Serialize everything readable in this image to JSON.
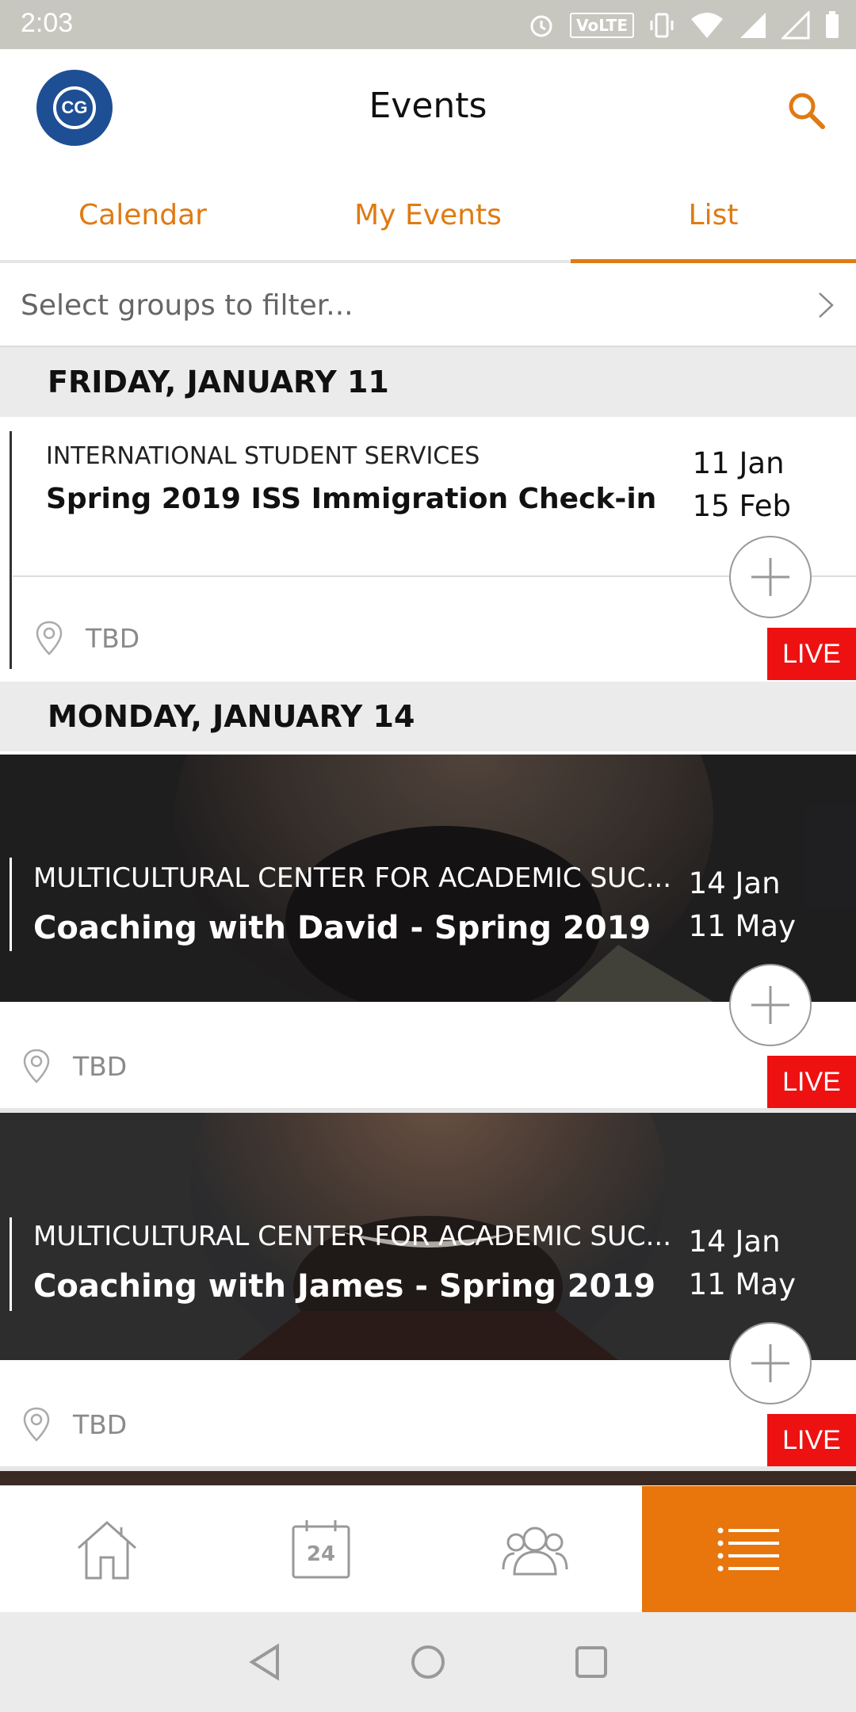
{
  "status_bar": {
    "time": "2:03",
    "volte_label": "VoLTE"
  },
  "header": {
    "title": "Events",
    "logo_text": "CG"
  },
  "tabs": [
    {
      "label": "Calendar",
      "active": false
    },
    {
      "label": "My Events",
      "active": false
    },
    {
      "label": "List",
      "active": true
    }
  ],
  "filter": {
    "placeholder": "Select groups to filter..."
  },
  "sections": [
    {
      "day_label": "FRIDAY, JANUARY 11",
      "events": [
        {
          "org": "INTERNATIONAL STUDENT SERVICES",
          "title": "Spring 2019 ISS Immigration Check-in",
          "start": "11 Jan",
          "end": "15 Feb",
          "location": "TBD",
          "badge": "LIVE"
        }
      ]
    },
    {
      "day_label": "MONDAY, JANUARY 14",
      "events": [
        {
          "org": "MULTICULTURAL CENTER FOR ACADEMIC SUC...",
          "title": "Coaching with David - Spring 2019",
          "start": "14 Jan",
          "end": "11 May",
          "location": "TBD",
          "badge": "LIVE"
        },
        {
          "org": "MULTICULTURAL CENTER FOR ACADEMIC SUC...",
          "title": "Coaching with James - Spring 2019",
          "start": "14 Jan",
          "end": "11 May",
          "location": "TBD",
          "badge": "LIVE"
        }
      ]
    }
  ],
  "bottom_nav": [
    {
      "icon": "home-icon",
      "active": false
    },
    {
      "icon": "calendar-icon",
      "label": "24",
      "active": false
    },
    {
      "icon": "groups-icon",
      "active": false
    },
    {
      "icon": "list-icon",
      "active": true
    }
  ],
  "colors": {
    "accent": "#e07a12",
    "live": "#ee1111",
    "logo": "#1e4f94"
  }
}
